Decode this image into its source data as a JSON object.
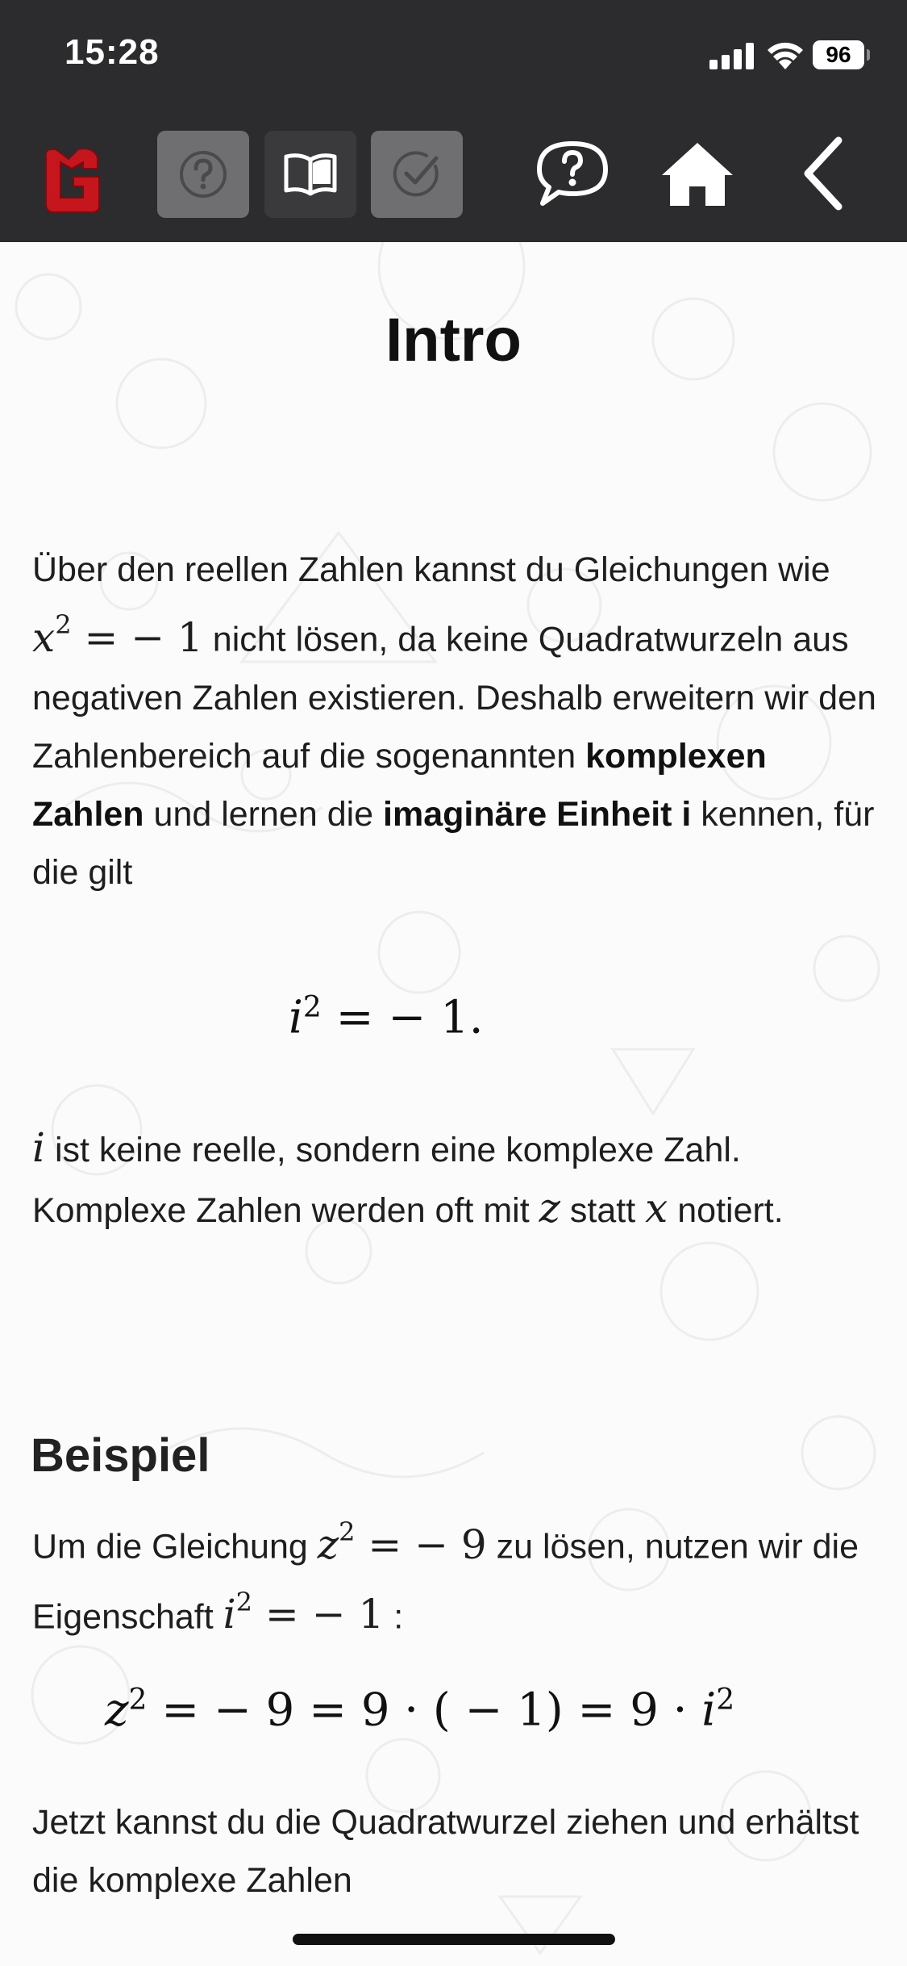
{
  "status_bar": {
    "time": "15:28",
    "battery": "96"
  },
  "toolbar": {
    "logo": "mathe-logo",
    "hint_icon": "question-circle-icon",
    "theory_icon": "open-book-icon",
    "check_icon": "checkmark-circle-icon",
    "chat_icon": "question-speech-bubble-icon",
    "home_icon": "home-icon",
    "back_icon": "chevron-left-icon",
    "colors": {
      "bar": "#2c2c2e",
      "logo": "#c4161c",
      "disabled_btn": "#6f6f71",
      "active_btn": "#3a3a3c"
    }
  },
  "content": {
    "title": "Intro",
    "intro": {
      "t1": "Über den reellen Zahlen kannst du Gleichungen wie ",
      "m1": "x",
      "m1_exp": "2",
      "m1_rest": " = − 1",
      "t2": " nicht lösen, da keine Quadratwurzeln aus negativen Zahlen existieren. Deshalb erweitern wir den Zahlenbereich auf die sogenannten ",
      "b1": "komplexen Zahlen",
      "t3": " und lernen die ",
      "b2": "imaginäre Einheit i",
      "t4": " kennen, für die gilt"
    },
    "formula1": {
      "var": "i",
      "exp": "2",
      "rest": " = − 1."
    },
    "para2": {
      "m1": "i",
      "t1": " ist keine reelle, sondern eine komplexe Zahl. Komplexe Zahlen werden oft mit ",
      "m2": "z",
      "t2": " statt ",
      "m3": "x",
      "t3": " notiert."
    },
    "example_heading": "Beispiel",
    "example": {
      "t1": "Um die Gleichung ",
      "m1": "z",
      "m1_exp": "2",
      "m1_rest": " = − 9",
      "t2": " zu lösen, nutzen wir die Eigenschaft ",
      "m2": "i",
      "m2_exp": "2",
      "m2_rest": " = − 1",
      "t3": " :"
    },
    "formula2": {
      "var1": "z",
      "exp1": "2",
      "mid": " = − 9 = 9 · ( − 1) = 9 · ",
      "var2": "i",
      "exp2": "2"
    },
    "para3": "Jetzt kannst du die Quadratwurzel ziehen und erhältst die komplexe Zahlen"
  }
}
